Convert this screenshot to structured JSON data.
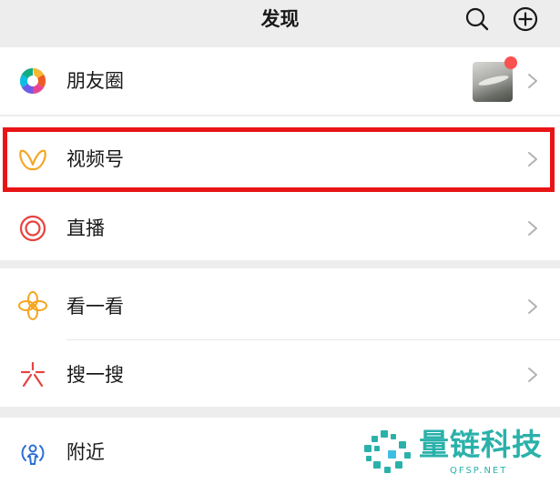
{
  "header": {
    "title": "发现",
    "search_icon": "search-icon",
    "add_icon": "plus-circle-icon"
  },
  "menu": {
    "moments": {
      "label": "朋友圈",
      "icon": "moments-aperture-icon",
      "has_new_badge": true
    },
    "channels": {
      "label": "视频号",
      "icon": "channels-icon",
      "highlighted": true
    },
    "live": {
      "label": "直播",
      "icon": "live-icon"
    },
    "top_stories": {
      "label": "看一看",
      "icon": "top-stories-icon"
    },
    "search": {
      "label": "搜一搜",
      "icon": "search-feature-icon"
    },
    "nearby": {
      "label": "附近",
      "icon": "nearby-icon"
    }
  },
  "watermark": {
    "name": "量链科技",
    "domain": "QFSP.NET"
  },
  "colors": {
    "background": "#ededed",
    "row": "#ffffff",
    "badge": "#fa5151",
    "highlight_border": "#e81416",
    "watermark": "#14a9a1",
    "channels_icon": "#f5a623"
  }
}
